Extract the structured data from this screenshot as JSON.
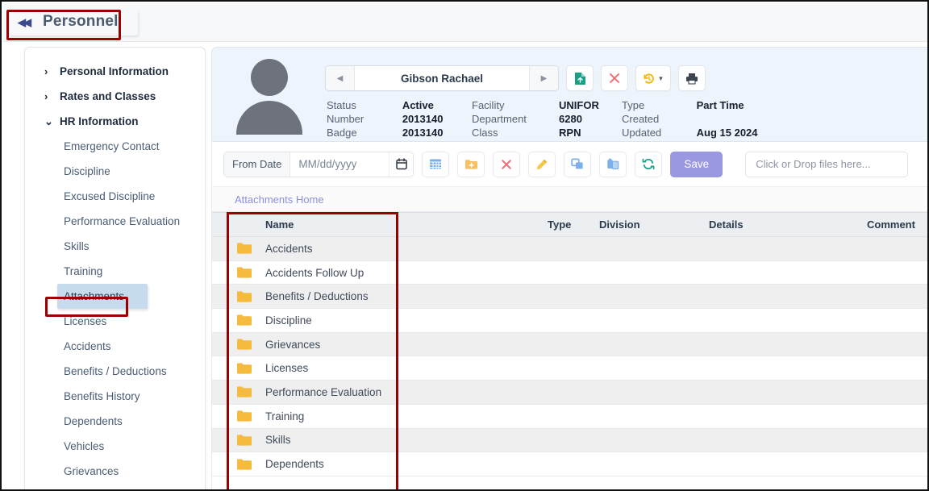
{
  "topbar": {
    "collapse_icon": "double-left-arrow",
    "module_title": "Personnel"
  },
  "sidebar": {
    "groups": [
      {
        "label": "Personal Information",
        "chevron": "chevron-right",
        "expanded": false
      },
      {
        "label": "Rates and Classes",
        "chevron": "chevron-right",
        "expanded": false
      },
      {
        "label": "HR Information",
        "chevron": "chevron-down",
        "expanded": true
      }
    ],
    "items": [
      {
        "label": "Emergency Contact",
        "active": false
      },
      {
        "label": "Discipline",
        "active": false
      },
      {
        "label": "Excused Discipline",
        "active": false
      },
      {
        "label": "Performance Evaluation",
        "active": false
      },
      {
        "label": "Skills",
        "active": false
      },
      {
        "label": "Training",
        "active": false
      },
      {
        "label": "Attachments",
        "active": true
      },
      {
        "label": "Licenses",
        "active": false
      },
      {
        "label": "Accidents",
        "active": false
      },
      {
        "label": "Benefits / Deductions",
        "active": false
      },
      {
        "label": "Benefits History",
        "active": false
      },
      {
        "label": "Dependents",
        "active": false
      },
      {
        "label": "Vehicles",
        "active": false
      },
      {
        "label": "Grievances",
        "active": false
      }
    ]
  },
  "employee": {
    "name": "Gibson Rachael",
    "prev_icon": "triangle-left-icon",
    "next_icon": "triangle-right-icon",
    "actions": [
      {
        "name": "save-record-icon",
        "glyph": "file-upload",
        "color": "#16a085"
      },
      {
        "name": "delete-record-icon",
        "glyph": "x",
        "color": "#ef6b72"
      },
      {
        "name": "history-icon",
        "glyph": "clock-undo",
        "color": "#f2b705"
      },
      {
        "name": "print-icon",
        "glyph": "printer",
        "color": "#3d4450"
      }
    ],
    "fields_col1": [
      {
        "label": "Status",
        "value": "Active"
      },
      {
        "label": "Number",
        "value": "2013140"
      },
      {
        "label": "Badge",
        "value": "2013140"
      }
    ],
    "fields_col2": [
      {
        "label": "Facility",
        "value": "UNIFOR"
      },
      {
        "label": "Department",
        "value": "6280"
      },
      {
        "label": "Class",
        "value": "RPN"
      }
    ],
    "fields_col3": [
      {
        "label": "Type",
        "value": "Part Time"
      },
      {
        "label": "Created",
        "value": ""
      },
      {
        "label": "Updated",
        "value": "Aug 15 2024"
      }
    ]
  },
  "toolbar": {
    "from_date_label": "From Date",
    "from_date_placeholder": "MM/dd/yyyy",
    "from_date_value": "MM/dd/yyyy",
    "calendar_icon": "calendar-icon",
    "buttons": [
      {
        "name": "grid-view-button",
        "glyph": "grid",
        "color": "#7bb0ea"
      },
      {
        "name": "new-folder-button",
        "glyph": "folder-plus",
        "color": "#f5c164"
      },
      {
        "name": "delete-button",
        "glyph": "x",
        "color": "#f06a77"
      },
      {
        "name": "edit-button",
        "glyph": "pencil",
        "color": "#f5c64a"
      },
      {
        "name": "copy-button",
        "glyph": "copy",
        "color": "#7bb0ea"
      },
      {
        "name": "paste-button",
        "glyph": "paste",
        "color": "#7bb0ea"
      },
      {
        "name": "refresh-button",
        "glyph": "refresh",
        "color": "#16a085"
      }
    ],
    "save_label": "Save",
    "dropzone_text": "Click or Drop files here..."
  },
  "breadcrumb": {
    "label": "Attachments Home"
  },
  "table": {
    "columns": [
      "",
      "",
      "Name",
      "Type",
      "Division",
      "Details",
      "Comment"
    ],
    "rows": [
      {
        "icon": "folder-icon",
        "name": "Accidents",
        "type": "",
        "division": "",
        "details": "",
        "comment": ""
      },
      {
        "icon": "folder-icon",
        "name": "Accidents Follow Up",
        "type": "",
        "division": "",
        "details": "",
        "comment": ""
      },
      {
        "icon": "folder-icon",
        "name": "Benefits / Deductions",
        "type": "",
        "division": "",
        "details": "",
        "comment": ""
      },
      {
        "icon": "folder-icon",
        "name": "Discipline",
        "type": "",
        "division": "",
        "details": "",
        "comment": ""
      },
      {
        "icon": "folder-icon",
        "name": "Grievances",
        "type": "",
        "division": "",
        "details": "",
        "comment": ""
      },
      {
        "icon": "folder-icon",
        "name": "Licenses",
        "type": "",
        "division": "",
        "details": "",
        "comment": ""
      },
      {
        "icon": "folder-icon",
        "name": "Performance Evaluation",
        "type": "",
        "division": "",
        "details": "",
        "comment": ""
      },
      {
        "icon": "folder-icon",
        "name": "Training",
        "type": "",
        "division": "",
        "details": "",
        "comment": ""
      },
      {
        "icon": "folder-icon",
        "name": "Skills",
        "type": "",
        "division": "",
        "details": "",
        "comment": ""
      },
      {
        "icon": "folder-icon",
        "name": "Dependents",
        "type": "",
        "division": "",
        "details": "",
        "comment": ""
      }
    ]
  },
  "annotations": {
    "highlight_color": "#9b0000",
    "boxes": [
      "module-title",
      "sidebar-attachments",
      "table-name-column"
    ]
  }
}
